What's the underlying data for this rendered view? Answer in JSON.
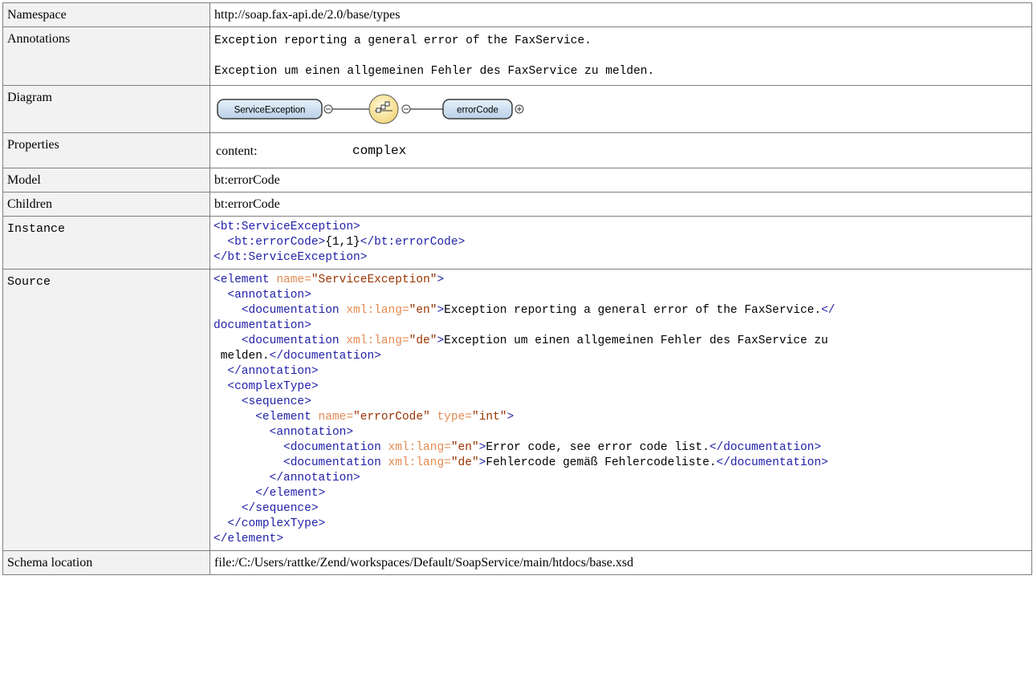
{
  "rows": {
    "namespace": {
      "label": "Namespace",
      "value": "http://soap.fax-api.de/2.0/base/types"
    },
    "annotations": {
      "label": "Annotations",
      "lines": [
        "Exception reporting a general error of the FaxService.",
        "Exception um einen allgemeinen Fehler des FaxService zu melden."
      ]
    },
    "diagram": {
      "label": "Diagram",
      "element_name": "ServiceException",
      "child_name": "errorCode",
      "expand_symbol": "+",
      "collapse_symbol": "−"
    },
    "properties": {
      "label": "Properties",
      "key": "content:",
      "value": "complex"
    },
    "model": {
      "label": "Model",
      "value": "bt:errorCode"
    },
    "children": {
      "label": "Children",
      "value": "bt:errorCode"
    },
    "instance": {
      "label": "Instance",
      "open_tag": "<bt:ServiceException>",
      "child_open": "<bt:errorCode>",
      "child_text": "{1,1}",
      "child_close": "</bt:errorCode>",
      "close_tag": "</bt:ServiceException>"
    },
    "source": {
      "label": "Source",
      "el_open": "<element",
      "attr_name": " name=",
      "attr_type": " type=",
      "attr_lang": " xml:lang=",
      "gt": ">",
      "root_name": "\"ServiceException\"",
      "annotation_open": "<annotation>",
      "annotation_close": "</annotation>",
      "doc_open": "<documentation",
      "doc_close_split_a": "</",
      "doc_close_split_b": "documentation>",
      "doc_close": "</documentation>",
      "lang_en": "\"en\"",
      "lang_de": "\"de\"",
      "root_doc_en": "Exception reporting a general error of the FaxService.",
      "root_doc_de_a": "Exception um einen allgemeinen Fehler des FaxService zu",
      "root_doc_de_b": " melden.",
      "complextype_open": "<complexType>",
      "complextype_close": "</complexType>",
      "sequence_open": "<sequence>",
      "sequence_close": "</sequence>",
      "child_name": "\"errorCode\"",
      "child_type": "\"int\"",
      "child_doc_en": "Error code, see error code list.",
      "child_doc_de": "Fehlercode gemäß Fehlercodeliste.",
      "element_close": "</element>"
    },
    "schema_location": {
      "label": "Schema location",
      "value": "file:/C:/Users/rattke/Zend/workspaces/Default/SoapService/main/htdocs/base.xsd"
    }
  },
  "colors": {
    "tag": "#1f1fa8",
    "attr": "#e28b52",
    "value": "#993300",
    "label_bg": "#f2f2f2",
    "border": "#7f7f7f"
  }
}
